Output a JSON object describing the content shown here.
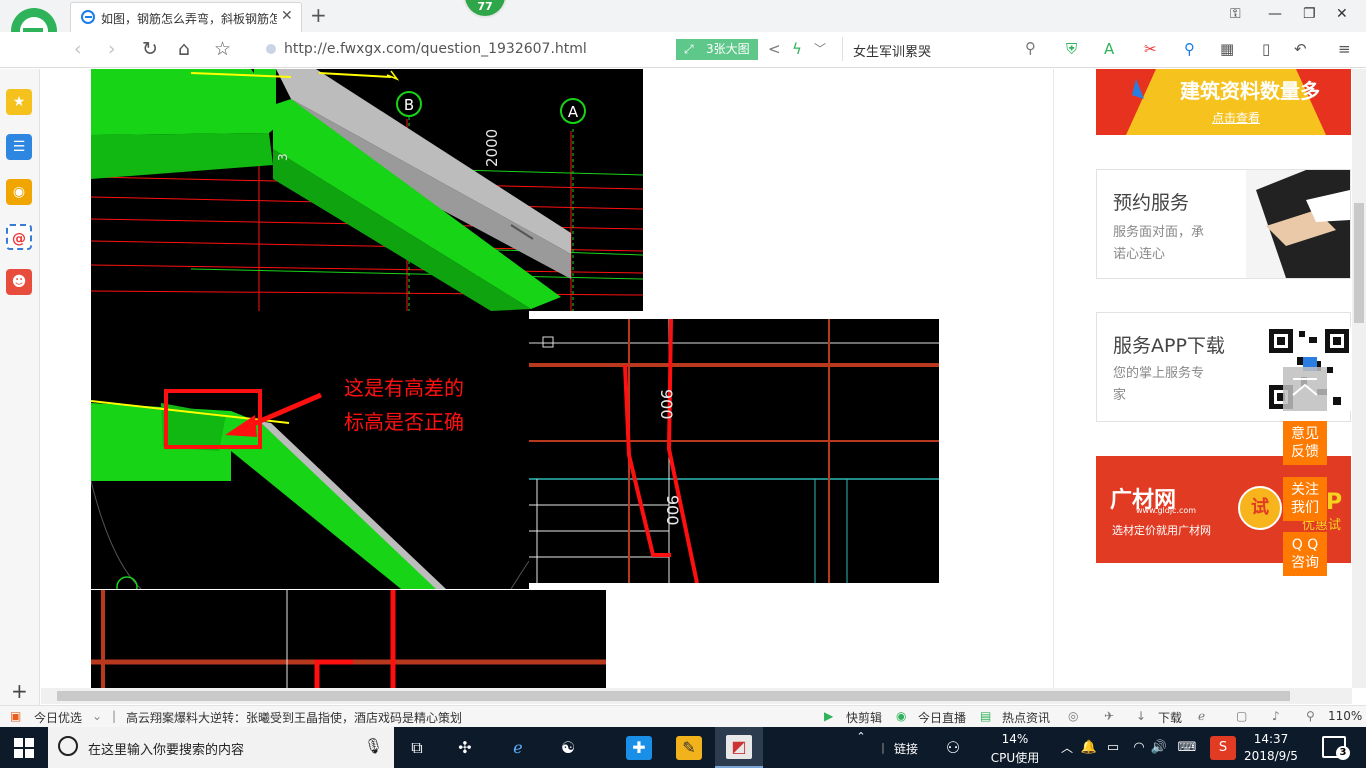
{
  "tabbar": {
    "tab_title": "如图，钢筋怎么弄弯，斜板钢筋怎么弄",
    "close_glyph": "✕",
    "new_tab_glyph": "+",
    "badge": "77",
    "window_controls": [
      "⚿",
      "—",
      "❐",
      "✕"
    ]
  },
  "addressbar": {
    "url": "http://e.fwxgx.com/question_1932607.html",
    "big_image_label": "3张大图",
    "search_text": "女生军训累哭",
    "back": "‹",
    "forward": "›",
    "refresh": "↻",
    "home": "⌂",
    "star": "☆"
  },
  "images": {
    "top": {
      "grid_b": "B",
      "grid_a": "A",
      "dim_2000": "2000",
      "dim_partial": "3"
    },
    "middle_left": {
      "annotation_line1": "这是有高差的",
      "annotation_line2": "标高是否正确"
    },
    "middle_right": {
      "dim_upper": "900",
      "dim_lower": "900"
    }
  },
  "sidebar_right": {
    "banner_text": "建筑资料数量多",
    "banner_sub": "点击查看",
    "card1": {
      "title": "预约服务",
      "sub_line1": "服务面对面，承",
      "sub_line2": "诺心连心"
    },
    "card2": {
      "title": "服务APP下载",
      "sub_line1": "您的掌上服务专",
      "sub_line2": "家"
    },
    "ad": {
      "brand": "广材网",
      "url": "www.gldjc.com",
      "slogan": "选材定价就用广材网",
      "try": "试",
      "tail1": "P",
      "tail2": "优惠试用"
    },
    "float_buttons": [
      {
        "line1": "意见",
        "line2": "反馈"
      },
      {
        "line1": "关注",
        "line2": "我们"
      },
      {
        "line1": "Q Q",
        "line2": "咨询"
      }
    ]
  },
  "statusbar": {
    "today_pick": "今日优选",
    "headline": "高云翔案爆料大逆转：张曦受到王晶指使，酒店戏码是精心策划",
    "quick_clip": "快剪辑",
    "today_live": "今日直播",
    "hot_news": "热点资讯",
    "download": "下载",
    "zoom": "110%"
  },
  "taskbar": {
    "search_placeholder": "在这里输入你要搜索的内容",
    "link": "链接",
    "cpu_pct": "14%",
    "cpu_label": "CPU使用",
    "time": "14:37",
    "date": "2018/9/5",
    "notif_count": "3"
  },
  "colors": {
    "cad_bg": "#000000",
    "cad_green": "#17d417",
    "cad_red": "#ff1010",
    "cad_dim": "#e8e8e8",
    "orange": "#ff7a00",
    "accent_green": "#5ec78a"
  }
}
